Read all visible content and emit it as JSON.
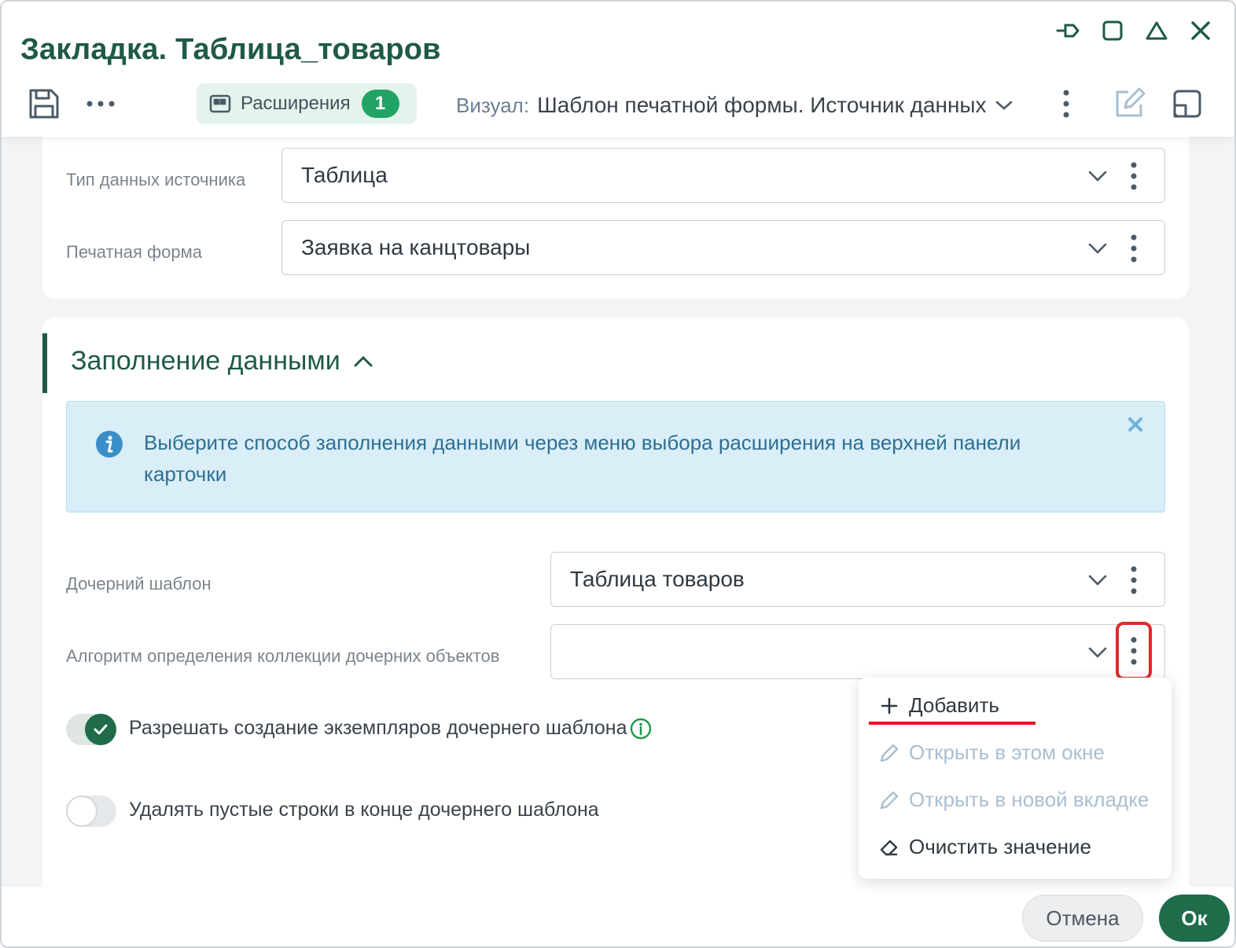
{
  "window": {
    "title": "Закладка. Таблица_товаров"
  },
  "toolbar": {
    "extensions_label": "Расширения",
    "extensions_count": "1",
    "visual_label": "Визуал:",
    "visual_value": "Шаблон печатной формы. Источник данных"
  },
  "fields": {
    "source_type": {
      "label": "Тип данных источника",
      "value": "Таблица"
    },
    "print_form": {
      "label": "Печатная форма",
      "value": "Заявка на канцтовары"
    },
    "child_template": {
      "label": "Дочерний шаблон",
      "value": "Таблица товаров"
    },
    "collection_algorithm": {
      "label": "Алгоритм определения коллекции дочерних объектов",
      "value": ""
    }
  },
  "section": {
    "title": "Заполнение данными",
    "info_text": "Выберите способ заполнения данными через меню выбора расширения на верхней панели карточки"
  },
  "toggles": {
    "allow_instances": {
      "label": "Разрешать создание экземпляров дочернего шаблона",
      "on": true
    },
    "delete_empty_rows": {
      "label": "Удалять пустые строки в конце дочернего шаблона",
      "on": false
    }
  },
  "context_menu": {
    "items": [
      {
        "label": "Добавить",
        "icon": "plus-icon",
        "enabled": true
      },
      {
        "label": "Открыть в этом окне",
        "icon": "pencil-icon",
        "enabled": false
      },
      {
        "label": "Открыть в новой вкладке",
        "icon": "pencil-icon",
        "enabled": false
      },
      {
        "label": "Очистить значение",
        "icon": "eraser-icon",
        "enabled": true
      }
    ]
  },
  "footer": {
    "cancel_label": "Отмена",
    "ok_label": "Ок"
  },
  "colors": {
    "brand_green": "#1f5a44",
    "badge_green": "#22a366",
    "info_bg": "#d9eef7",
    "highlight_red": "#e02a2a"
  }
}
